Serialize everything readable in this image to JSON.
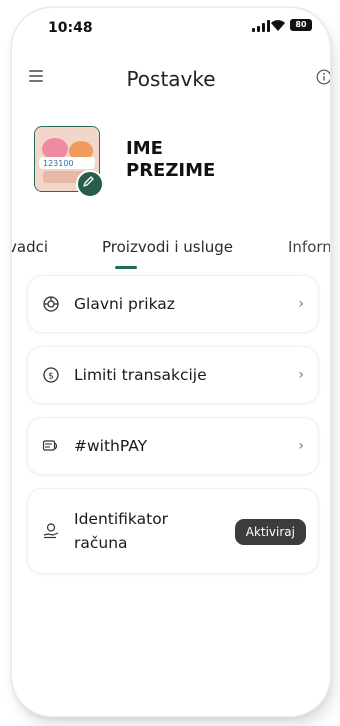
{
  "status_bar": {
    "time": "10:48",
    "battery": "80"
  },
  "header": {
    "title": "Postavke"
  },
  "profile": {
    "name_line1": "IME",
    "name_line2": "PREZIME"
  },
  "tabs": [
    {
      "label": "vadci"
    },
    {
      "label": "Proizvodi i usluge",
      "active": true
    },
    {
      "label": "Inforn"
    }
  ],
  "menu": {
    "items": [
      {
        "label": "Glavni prikaz",
        "icon": "dashboard-icon"
      },
      {
        "label": "Limiti transakcije",
        "icon": "dollar-circle-icon"
      },
      {
        "label": "#withPAY",
        "icon": "card-tap-icon"
      }
    ],
    "identifier": {
      "line1": "Identifikator",
      "line2": "računa",
      "button": "Aktiviraj",
      "icon": "hand-coin-icon"
    }
  },
  "colors": {
    "accent": "#1f6b57",
    "button": "#3c3c3c"
  }
}
